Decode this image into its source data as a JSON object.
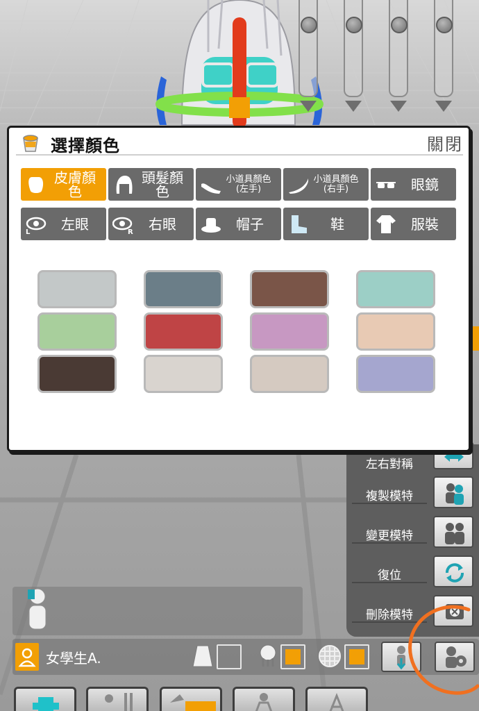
{
  "dialog": {
    "title": "選擇顏色",
    "close_label": "關閉",
    "tabs_row1": [
      {
        "name": "tab-skin-color",
        "label": "皮膚顏色",
        "icon": "skin-icon",
        "active": true,
        "small": false
      },
      {
        "name": "tab-hair-color",
        "label": "頭髮顏色",
        "icon": "hair-icon",
        "active": false,
        "small": false
      },
      {
        "name": "tab-prop-left",
        "label": "小道具顏色(左手)",
        "icon": "prop-left-icon",
        "active": false,
        "small": true
      },
      {
        "name": "tab-prop-right",
        "label": "小道具顏色(右手)",
        "icon": "prop-right-icon",
        "active": false,
        "small": true
      },
      {
        "name": "tab-glasses",
        "label": "眼鏡",
        "icon": "glasses-icon",
        "active": false,
        "small": false
      }
    ],
    "tabs_row2": [
      {
        "name": "tab-left-eye",
        "label": "左眼",
        "icon": "left-eye-icon",
        "active": false,
        "small": false
      },
      {
        "name": "tab-right-eye",
        "label": "右眼",
        "icon": "right-eye-icon",
        "active": false,
        "small": false
      },
      {
        "name": "tab-hat",
        "label": "帽子",
        "icon": "hat-icon",
        "active": false,
        "small": false
      },
      {
        "name": "tab-shoes",
        "label": "鞋",
        "icon": "shoe-icon",
        "active": false,
        "small": false
      },
      {
        "name": "tab-clothes",
        "label": "服裝",
        "icon": "clothes-icon",
        "active": false,
        "small": false
      }
    ],
    "swatches": [
      "#c3c8c8",
      "#6b7e88",
      "#7a5548",
      "#9ccfc6",
      "#a8cf9c",
      "#bf4445",
      "#c798c2",
      "#e8cab4",
      "#4a3a34",
      "#d9d4cf",
      "#d5cac1",
      "#a5a6cf"
    ]
  },
  "side_menu": {
    "partial_label": "左右對稱",
    "items": [
      {
        "name": "copy-model",
        "label": "複製模特",
        "icon": "copy-model-icon"
      },
      {
        "name": "change-model",
        "label": "變更模特",
        "icon": "change-model-icon"
      },
      {
        "name": "reset",
        "label": "復位",
        "icon": "reset-icon"
      },
      {
        "name": "delete-model",
        "label": "刪除模特",
        "icon": "delete-model-icon"
      }
    ]
  },
  "model_bar": {
    "model_name": "女學生A."
  },
  "colors": {
    "accent": "#f29f05",
    "tab_bg": "#6a6a6a",
    "menu_bg": "#5e5e5e",
    "annotation": "#f07020"
  }
}
